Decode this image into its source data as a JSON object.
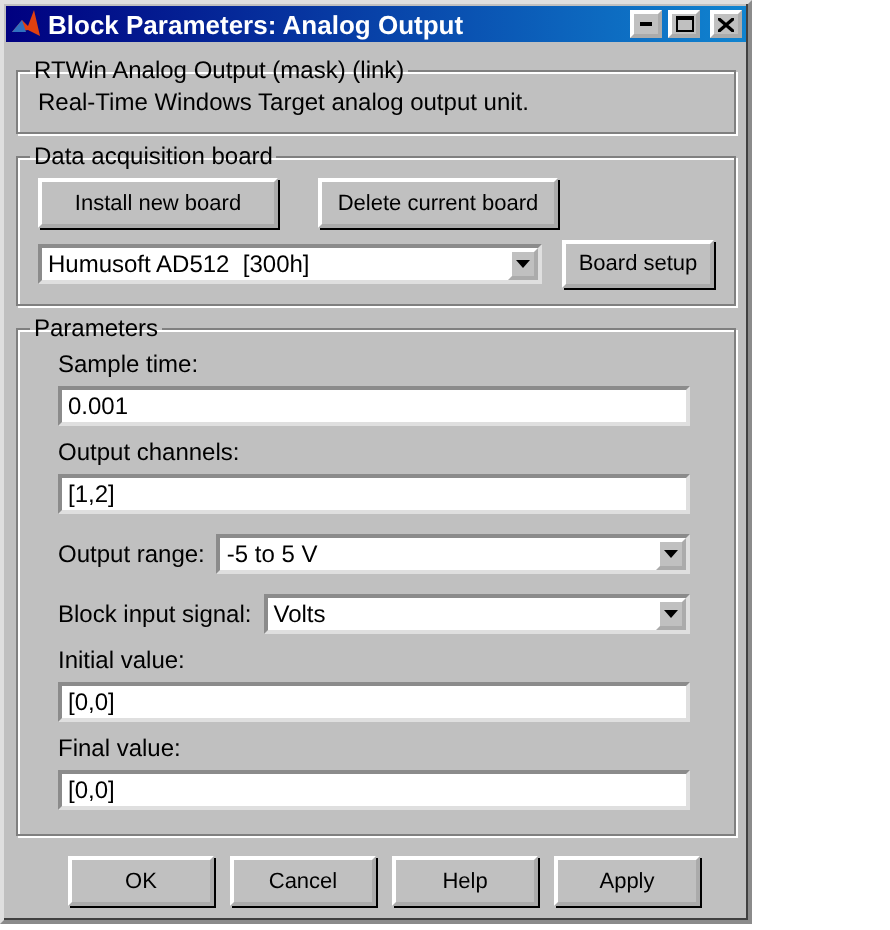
{
  "window": {
    "title": "Block Parameters: Analog Output"
  },
  "description": {
    "title": "RTWin Analog Output (mask) (link)",
    "text": "Real-Time Windows Target analog output unit."
  },
  "board": {
    "title": "Data acquisition board",
    "buttons": [
      "Install new board",
      "Delete current board"
    ],
    "selected_board": "Humusoft AD512  [300h]",
    "setup_button": "Board setup"
  },
  "parameters": {
    "title": "Parameters",
    "items": [
      {
        "kind": "text",
        "label": "Sample time:",
        "value": "0.001"
      },
      {
        "kind": "text",
        "label": "Output channels:",
        "value": "[1,2]"
      },
      {
        "kind": "select",
        "label": "Output range:",
        "value": "-5 to 5 V"
      },
      {
        "kind": "select",
        "label": "Block input signal:",
        "value": "Volts"
      },
      {
        "kind": "text",
        "label": "Initial value:",
        "value": "[0,0]"
      },
      {
        "kind": "text",
        "label": "Final value:",
        "value": "[0,0]"
      }
    ]
  },
  "buttons": [
    "OK",
    "Cancel",
    "Help",
    "Apply"
  ]
}
